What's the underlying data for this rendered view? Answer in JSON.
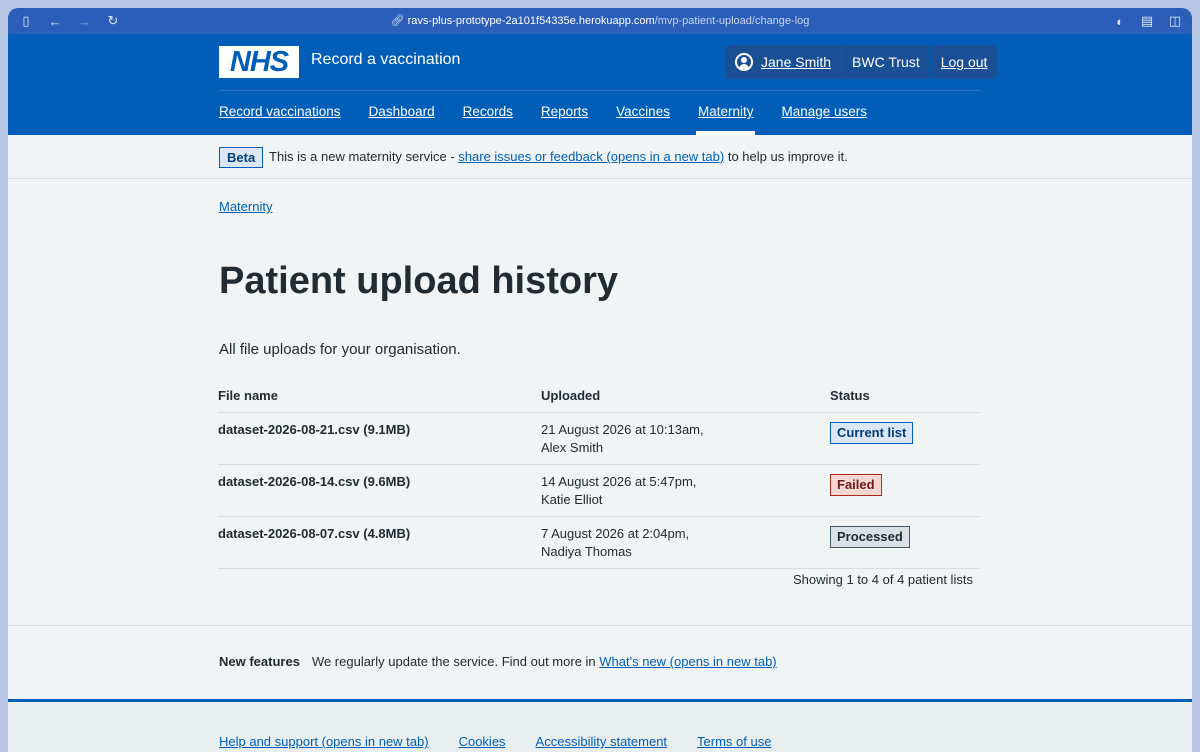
{
  "browser": {
    "url_host": "ravs-plus-prototype-2a101f54335e.herokuapp.com",
    "url_path": "/mvp-patient-upload/change-log"
  },
  "header": {
    "logo_text": "NHS",
    "service_name": "Record a vaccination",
    "user_name": "Jane Smith",
    "organisation": "BWC Trust",
    "logout_label": "Log out"
  },
  "nav": {
    "items": [
      {
        "label": "Record vaccinations"
      },
      {
        "label": "Dashboard"
      },
      {
        "label": "Records"
      },
      {
        "label": "Reports"
      },
      {
        "label": "Vaccines"
      },
      {
        "label": "Maternity"
      },
      {
        "label": "Manage users"
      }
    ],
    "active": "Maternity"
  },
  "beta": {
    "tag": "Beta",
    "text_before": "This is a new maternity service - ",
    "link": "share issues or feedback (opens in a new tab)",
    "text_after": " to help us improve it."
  },
  "breadcrumb": "Maternity",
  "page_title": "Patient upload history",
  "lede": "All file uploads for your organisation.",
  "table": {
    "headers": {
      "file": "File name",
      "uploaded": "Uploaded",
      "status": "Status"
    },
    "rows": [
      {
        "file": "dataset-2026-08-21.csv (9.1MB)",
        "uploaded_line1": "21 August 2026 at 10:13am,",
        "uploaded_line2": "Alex Smith",
        "status": "Current list"
      },
      {
        "file": "dataset-2026-08-14.csv (9.6MB)",
        "uploaded_line1": "14 August 2026 at 5:47pm,",
        "uploaded_line2": "Katie Elliot",
        "status": "Failed"
      },
      {
        "file": "dataset-2026-08-07.csv (4.8MB)",
        "uploaded_line1": "7 August 2026 at 2:04pm,",
        "uploaded_line2": "Nadiya Thomas",
        "status": "Processed"
      }
    ]
  },
  "pagination_summary": "Showing 1 to 4 of 4 patient lists",
  "new_features": {
    "label": "New features",
    "text": "We regularly update the service. Find out more in ",
    "link": "What's new (opens in new tab)"
  },
  "footer": {
    "links": [
      "Help and support (opens in new tab)",
      "Cookies",
      "Accessibility statement",
      "Terms of use"
    ]
  },
  "colors": {
    "nhs_blue": "#005eb8",
    "background": "#f0f4f5",
    "status_current": "#dbe7f6",
    "status_failed": "#f6d7d2",
    "status_processed": "#dbe0e4"
  }
}
